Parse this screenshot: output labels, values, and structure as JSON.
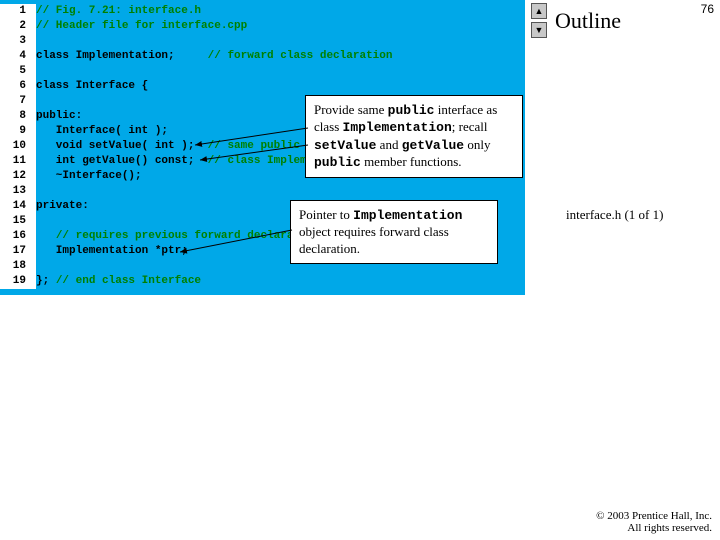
{
  "slide_number": "76",
  "outline_label": "Outline",
  "caption": "interface.h (1 of 1)",
  "copyright_line1": "© 2003 Prentice Hall, Inc.",
  "copyright_line2": "All rights reserved.",
  "nav": {
    "up": "▲",
    "down": "▼"
  },
  "code": {
    "l1": "// Fig. 7.21: interface.h",
    "l2": "// Header file for interface.cpp",
    "l3": "",
    "l4a": "class Implementation;     ",
    "l4b": "// forward class declaration",
    "l5": "",
    "l6": "class Interface {",
    "l7": "",
    "l8": "public:",
    "l9": "   Interface( int );",
    "l10a": "   void setValue( int );  ",
    "l10b": "// same public interface as",
    "l11a": "   int getValue() const;  ",
    "l11b": "// class Implementation",
    "l12": "   ~Interface();",
    "l13": "",
    "l14": "private:",
    "l15": "",
    "l16a": "   ",
    "l16b": "// requires previous forward declaration",
    "l17": "   Implementation *ptr;",
    "l18": "",
    "l19a": "}; ",
    "l19b": "// end class Interface"
  },
  "callout1": {
    "t1": "Provide same ",
    "t2": "public",
    "t3": " interface as class ",
    "t4": "Implementation",
    "t5": "; recall ",
    "t6": "setValue",
    "t7": " and ",
    "t8": "getValue",
    "t9": " only ",
    "t10": "public",
    "t11": " member functions."
  },
  "callout2": {
    "t1": "Pointer to ",
    "t2": "Implementation",
    "t3": " object requires forward class declaration."
  }
}
